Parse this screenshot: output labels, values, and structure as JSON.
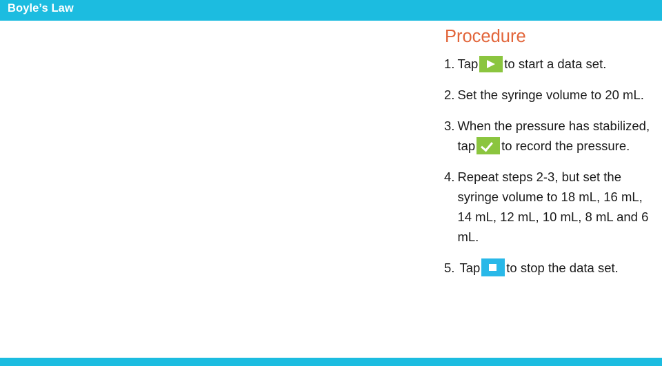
{
  "slide": {
    "title": "Boyle’s Law",
    "accent_color": "#1CBCE0",
    "heading_color": "#E2653A",
    "heading": "Procedure",
    "steps": [
      {
        "number": "1.",
        "text_before": "Tap",
        "icon": "play-icon",
        "icon_color": "#8BC53F",
        "text_after": "to start a data set."
      },
      {
        "number": "2.",
        "text_before": "Set the syringe volume to 20 mL.",
        "icon": null,
        "text_after": ""
      },
      {
        "number": "3.",
        "text_before": "When the pressure has stabilized, tap",
        "icon": "check-icon",
        "icon_color": "#8BC53F",
        "text_after": "to record the pressure."
      },
      {
        "number": "4.",
        "text_before": "Repeat steps 2-3, but set the syringe volume to 18 mL, 16 mL, 14 mL, 12 mL, 10 mL, 8 mL and 6 mL.",
        "icon": null,
        "text_after": ""
      },
      {
        "number": "5.",
        "text_before": "Tap",
        "icon": "stop-icon",
        "icon_color": "#29B8E8",
        "text_after": "to stop the data set."
      }
    ]
  }
}
